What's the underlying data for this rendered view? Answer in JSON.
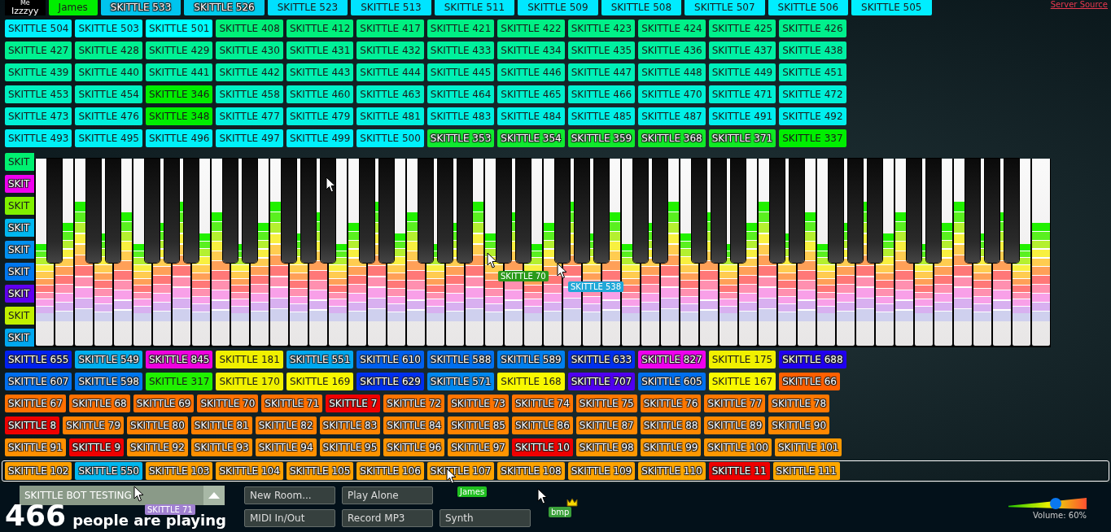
{
  "server_link": "Server Source",
  "top_row": [
    {
      "name": "Izzzyy",
      "me_label": "Me",
      "color": "#000000"
    },
    {
      "name": "James",
      "color": "#00ee00"
    },
    {
      "name": "SKITTLE 533",
      "color": "#00c4ee"
    },
    {
      "name": "SKITTLE 526",
      "color": "#00ccee"
    },
    {
      "name": "SKITTLE 523",
      "color": "#00e0ff"
    },
    {
      "name": "SKITTLE 513",
      "color": "#00e4ff"
    },
    {
      "name": "SKITTLE 511",
      "color": "#00e8ff"
    },
    {
      "name": "SKITTLE 509",
      "color": "#00e8ff"
    },
    {
      "name": "SKITTLE 508",
      "color": "#00ecff"
    },
    {
      "name": "SKITTLE 507",
      "color": "#00ecff"
    },
    {
      "name": "SKITTLE 506",
      "color": "#00eeff"
    },
    {
      "name": "SKITTLE 505",
      "color": "#00eeff"
    }
  ],
  "rows_above": [
    [
      {
        "name": "SKITTLE 504",
        "color": "#00f0ff"
      },
      {
        "name": "SKITTLE 503",
        "color": "#00f4ff"
      },
      {
        "name": "SKITTLE 501",
        "color": "#00ffff"
      },
      {
        "name": "SKITTLE 408",
        "color": "#00f078"
      },
      {
        "name": "SKITTLE 412",
        "color": "#00f07c"
      },
      {
        "name": "SKITTLE 417",
        "color": "#00f080"
      },
      {
        "name": "SKITTLE 421",
        "color": "#00f084"
      },
      {
        "name": "SKITTLE 422",
        "color": "#00f084"
      },
      {
        "name": "SKITTLE 423",
        "color": "#00f088"
      },
      {
        "name": "SKITTLE 424",
        "color": "#00f088"
      },
      {
        "name": "SKITTLE 425",
        "color": "#00f08c"
      },
      {
        "name": "SKITTLE 426",
        "color": "#00f08c"
      }
    ],
    [
      {
        "name": "SKITTLE 427",
        "color": "#00f090"
      },
      {
        "name": "SKITTLE 428",
        "color": "#00f090"
      },
      {
        "name": "SKITTLE 429",
        "color": "#00f094"
      },
      {
        "name": "SKITTLE 430",
        "color": "#00f094"
      },
      {
        "name": "SKITTLE 431",
        "color": "#00f098"
      },
      {
        "name": "SKITTLE 432",
        "color": "#00f098"
      },
      {
        "name": "SKITTLE 433",
        "color": "#00f09c"
      },
      {
        "name": "SKITTLE 434",
        "color": "#00f09c"
      },
      {
        "name": "SKITTLE 435",
        "color": "#00f0a0"
      },
      {
        "name": "SKITTLE 436",
        "color": "#00f0a0"
      },
      {
        "name": "SKITTLE 437",
        "color": "#00f0a4"
      },
      {
        "name": "SKITTLE 438",
        "color": "#00f0a4"
      }
    ],
    [
      {
        "name": "SKITTLE 439",
        "color": "#00f0a8"
      },
      {
        "name": "SKITTLE 440",
        "color": "#00f0a8"
      },
      {
        "name": "SKITTLE 441",
        "color": "#00f0ac"
      },
      {
        "name": "SKITTLE 442",
        "color": "#00f0ac"
      },
      {
        "name": "SKITTLE 443",
        "color": "#00f0b0"
      },
      {
        "name": "SKITTLE 444",
        "color": "#00f0b0"
      },
      {
        "name": "SKITTLE 445",
        "color": "#00f0b4"
      },
      {
        "name": "SKITTLE 446",
        "color": "#00f0b4"
      },
      {
        "name": "SKITTLE 447",
        "color": "#00f0b8"
      },
      {
        "name": "SKITTLE 448",
        "color": "#00f0b8"
      },
      {
        "name": "SKITTLE 449",
        "color": "#00f0bc"
      },
      {
        "name": "SKITTLE 451",
        "color": "#00f0bc"
      }
    ],
    [
      {
        "name": "SKITTLE 453",
        "color": "#00f0c0"
      },
      {
        "name": "SKITTLE 454",
        "color": "#00f0c0"
      },
      {
        "name": "SKITTLE 346",
        "color": "#00ee00"
      },
      {
        "name": "SKITTLE 458",
        "color": "#00f0c4"
      },
      {
        "name": "SKITTLE 460",
        "color": "#00f0c8"
      },
      {
        "name": "SKITTLE 463",
        "color": "#00f0c8"
      },
      {
        "name": "SKITTLE 464",
        "color": "#00f0cc"
      },
      {
        "name": "SKITTLE 465",
        "color": "#00f0cc"
      },
      {
        "name": "SKITTLE 466",
        "color": "#00f0d0"
      },
      {
        "name": "SKITTLE 470",
        "color": "#00f0d4"
      },
      {
        "name": "SKITTLE 471",
        "color": "#00f0d4"
      },
      {
        "name": "SKITTLE 472",
        "color": "#00f0d8"
      }
    ],
    [
      {
        "name": "SKITTLE 473",
        "color": "#00f0d8"
      },
      {
        "name": "SKITTLE 476",
        "color": "#00f0dc"
      },
      {
        "name": "SKITTLE 348",
        "color": "#00ee00"
      },
      {
        "name": "SKITTLE 477",
        "color": "#00f0dc"
      },
      {
        "name": "SKITTLE 479",
        "color": "#00f0e0"
      },
      {
        "name": "SKITTLE 481",
        "color": "#00f0e0"
      },
      {
        "name": "SKITTLE 483",
        "color": "#00f0e4"
      },
      {
        "name": "SKITTLE 484",
        "color": "#00f0e4"
      },
      {
        "name": "SKITTLE 485",
        "color": "#00f0e8"
      },
      {
        "name": "SKITTLE 487",
        "color": "#00f0e8"
      },
      {
        "name": "SKITTLE 491",
        "color": "#00f0f0"
      },
      {
        "name": "SKITTLE 492",
        "color": "#00f0f0"
      }
    ],
    [
      {
        "name": "SKITTLE 493",
        "color": "#00f0f4"
      },
      {
        "name": "SKITTLE 495",
        "color": "#00f0f4"
      },
      {
        "name": "SKITTLE 496",
        "color": "#00f0f8"
      },
      {
        "name": "SKITTLE 497",
        "color": "#00f0f8"
      },
      {
        "name": "SKITTLE 499",
        "color": "#00f0fc"
      },
      {
        "name": "SKITTLE 500",
        "color": "#00f0fc"
      },
      {
        "name": "SKITTLE 353",
        "color": "#10ea30"
      },
      {
        "name": "SKITTLE 354",
        "color": "#10ea30"
      },
      {
        "name": "SKITTLE 359",
        "color": "#10ea2c"
      },
      {
        "name": "SKITTLE 368",
        "color": "#10ea28"
      },
      {
        "name": "SKITTLE 371",
        "color": "#10ea24"
      },
      {
        "name": "SKITTLE 337",
        "color": "#00ee00"
      }
    ]
  ],
  "side_tags": [
    {
      "name": "SKIT",
      "color": "#00f070"
    },
    {
      "name": "SKIT",
      "color": "#f000f0"
    },
    {
      "name": "SKIT",
      "color": "#80f000"
    },
    {
      "name": "SKIT",
      "color": "#00b8f0"
    },
    {
      "name": "SKIT",
      "color": "#0090f0"
    },
    {
      "name": "SKIT",
      "color": "#0078f0"
    },
    {
      "name": "SKIT",
      "color": "#6000f0"
    },
    {
      "name": "SKIT",
      "color": "#c0f000"
    },
    {
      "name": "SKIT",
      "color": "#00a8f0"
    }
  ],
  "rows_below": [
    [
      {
        "name": "SKITTLE 655",
        "color": "#0020f0"
      },
      {
        "name": "SKITTLE 549",
        "color": "#00b0f0"
      },
      {
        "name": "SKITTLE 845",
        "color": "#f000e0"
      },
      {
        "name": "SKITTLE 181",
        "color": "#f0f000"
      },
      {
        "name": "SKITTLE 551",
        "color": "#00a8f0"
      },
      {
        "name": "SKITTLE 610",
        "color": "#0060f0"
      },
      {
        "name": "SKITTLE 588",
        "color": "#0070f0"
      },
      {
        "name": "SKITTLE 589",
        "color": "#0080f0"
      },
      {
        "name": "SKITTLE 633",
        "color": "#0030f0"
      },
      {
        "name": "SKITTLE 827",
        "color": "#f000f0"
      },
      {
        "name": "SKITTLE 175",
        "color": "#f0f000"
      },
      {
        "name": "SKITTLE 688",
        "color": "#2000f0"
      }
    ],
    [
      {
        "name": "SKITTLE 607",
        "color": "#0070f0"
      },
      {
        "name": "SKITTLE 598",
        "color": "#0078f0"
      },
      {
        "name": "SKITTLE 317",
        "color": "#20f000"
      },
      {
        "name": "SKITTLE 170",
        "color": "#f0f000"
      },
      {
        "name": "SKITTLE 169",
        "color": "#f8f800"
      },
      {
        "name": "SKITTLE 629",
        "color": "#0030f0"
      },
      {
        "name": "SKITTLE 571",
        "color": "#0088f0"
      },
      {
        "name": "SKITTLE 168",
        "color": "#f8f800"
      },
      {
        "name": "SKITTLE 707",
        "color": "#5000f0"
      },
      {
        "name": "SKITTLE 605",
        "color": "#0070f0"
      },
      {
        "name": "SKITTLE 167",
        "color": "#f8f800"
      },
      {
        "name": "SKITTLE 66",
        "color": "#ff6000"
      }
    ],
    [
      {
        "name": "SKITTLE 67",
        "color": "#ff7000"
      },
      {
        "name": "SKITTLE 68",
        "color": "#ff7000"
      },
      {
        "name": "SKITTLE 69",
        "color": "#ff7000"
      },
      {
        "name": "SKITTLE 70",
        "color": "#ff7000"
      },
      {
        "name": "SKITTLE 71",
        "color": "#ff7000"
      },
      {
        "name": "SKITTLE 7",
        "color": "#f00000"
      },
      {
        "name": "SKITTLE 72",
        "color": "#ff7400"
      },
      {
        "name": "SKITTLE 73",
        "color": "#ff7400"
      },
      {
        "name": "SKITTLE 74",
        "color": "#ff7400"
      },
      {
        "name": "SKITTLE 75",
        "color": "#ff7800"
      },
      {
        "name": "SKITTLE 76",
        "color": "#ff7800"
      },
      {
        "name": "SKITTLE 77",
        "color": "#ff7800"
      },
      {
        "name": "SKITTLE 78",
        "color": "#ff7800"
      }
    ],
    [
      {
        "name": "SKITTLE 8",
        "color": "#f00000"
      },
      {
        "name": "SKITTLE 79",
        "color": "#ff8000"
      },
      {
        "name": "SKITTLE 80",
        "color": "#ff8000"
      },
      {
        "name": "SKITTLE 81",
        "color": "#ff8000"
      },
      {
        "name": "SKITTLE 82",
        "color": "#ff8000"
      },
      {
        "name": "SKITTLE 83",
        "color": "#ff8400"
      },
      {
        "name": "SKITTLE 84",
        "color": "#ff8400"
      },
      {
        "name": "SKITTLE 85",
        "color": "#ff8400"
      },
      {
        "name": "SKITTLE 86",
        "color": "#ff8400"
      },
      {
        "name": "SKITTLE 87",
        "color": "#ff8800"
      },
      {
        "name": "SKITTLE 88",
        "color": "#ff8800"
      },
      {
        "name": "SKITTLE 89",
        "color": "#ff8800"
      },
      {
        "name": "SKITTLE 90",
        "color": "#ff8800"
      }
    ],
    [
      {
        "name": "SKITTLE 91",
        "color": "#ff9000"
      },
      {
        "name": "SKITTLE 9",
        "color": "#f00000"
      },
      {
        "name": "SKITTLE 92",
        "color": "#ff9000"
      },
      {
        "name": "SKITTLE 93",
        "color": "#ff9000"
      },
      {
        "name": "SKITTLE 94",
        "color": "#ff9000"
      },
      {
        "name": "SKITTLE 95",
        "color": "#ff9400"
      },
      {
        "name": "SKITTLE 96",
        "color": "#ff9400"
      },
      {
        "name": "SKITTLE 97",
        "color": "#ff9400"
      },
      {
        "name": "SKITTLE 10",
        "color": "#f00000"
      },
      {
        "name": "SKITTLE 98",
        "color": "#ff9800"
      },
      {
        "name": "SKITTLE 99",
        "color": "#ff9800"
      },
      {
        "name": "SKITTLE 100",
        "color": "#ff9800"
      },
      {
        "name": "SKITTLE 101",
        "color": "#ff9800"
      }
    ]
  ],
  "outlined_row": [
    {
      "name": "SKITTLE 102",
      "color": "#ffa000"
    },
    {
      "name": "SKITTLE 550",
      "color": "#00b8f0"
    },
    {
      "name": "SKITTLE 103",
      "color": "#ffa000"
    },
    {
      "name": "SKITTLE 104",
      "color": "#ffa000"
    },
    {
      "name": "SKITTLE 105",
      "color": "#ffa000"
    },
    {
      "name": "SKITTLE 106",
      "color": "#ffa400"
    },
    {
      "name": "SKITTLE 107",
      "color": "#ffa400"
    },
    {
      "name": "SKITTLE 108",
      "color": "#ffa400"
    },
    {
      "name": "SKITTLE 109",
      "color": "#ffa400"
    },
    {
      "name": "SKITTLE 110",
      "color": "#ffa800"
    },
    {
      "name": "SKITTLE 11",
      "color": "#f00000"
    },
    {
      "name": "SKITTLE 111",
      "color": "#ffa800"
    }
  ],
  "cursors": [
    {
      "name": "SKITTLE 70",
      "color": "#2a9a1a"
    },
    {
      "name": "SKITTLE 538",
      "color": "#20a8d8"
    },
    {
      "name": "SKITTLE 71",
      "color": "#a080d0"
    },
    {
      "name": "James",
      "color": "#20c020"
    },
    {
      "name": "bmp",
      "color": "#3aa03a",
      "crown": true
    }
  ],
  "room": {
    "name": "SKITTLE BOT TESTING"
  },
  "player_count": "466",
  "player_count_label": "people are playing",
  "buttons": [
    [
      "New Room...",
      "Play Alone"
    ],
    [
      "MIDI In/Out",
      "Record MP3",
      "Synth"
    ]
  ],
  "volume": {
    "level": 0.6,
    "label": "Volume: 60%"
  }
}
